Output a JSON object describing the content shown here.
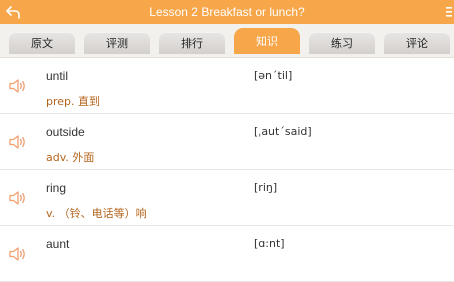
{
  "header": {
    "title": "Lesson 2 Breakfast or lunch?",
    "back_icon": "back-arrow-icon",
    "menu_icon": "menu-icon"
  },
  "tabs": [
    {
      "label": "原文",
      "active": false
    },
    {
      "label": "评测",
      "active": false
    },
    {
      "label": "排行",
      "active": false
    },
    {
      "label": "知识",
      "active": true
    },
    {
      "label": "练习",
      "active": false
    },
    {
      "label": "评论",
      "active": false
    }
  ],
  "words": [
    {
      "word": "until",
      "meaning": "prep. 直到",
      "phonetic": "[ən΄til]"
    },
    {
      "word": "outside",
      "meaning": "adv. 外面",
      "phonetic": "[ˌaut΄said]"
    },
    {
      "word": "ring",
      "meaning": "v. （铃、电话等）响",
      "phonetic": "[riŋ]"
    },
    {
      "word": "aunt",
      "meaning": "",
      "phonetic": "[ɑ:nt]"
    }
  ],
  "colors": {
    "accent": "#f7a64a",
    "meaning_text": "#b5651d",
    "speaker_icon": "#f0a070"
  }
}
